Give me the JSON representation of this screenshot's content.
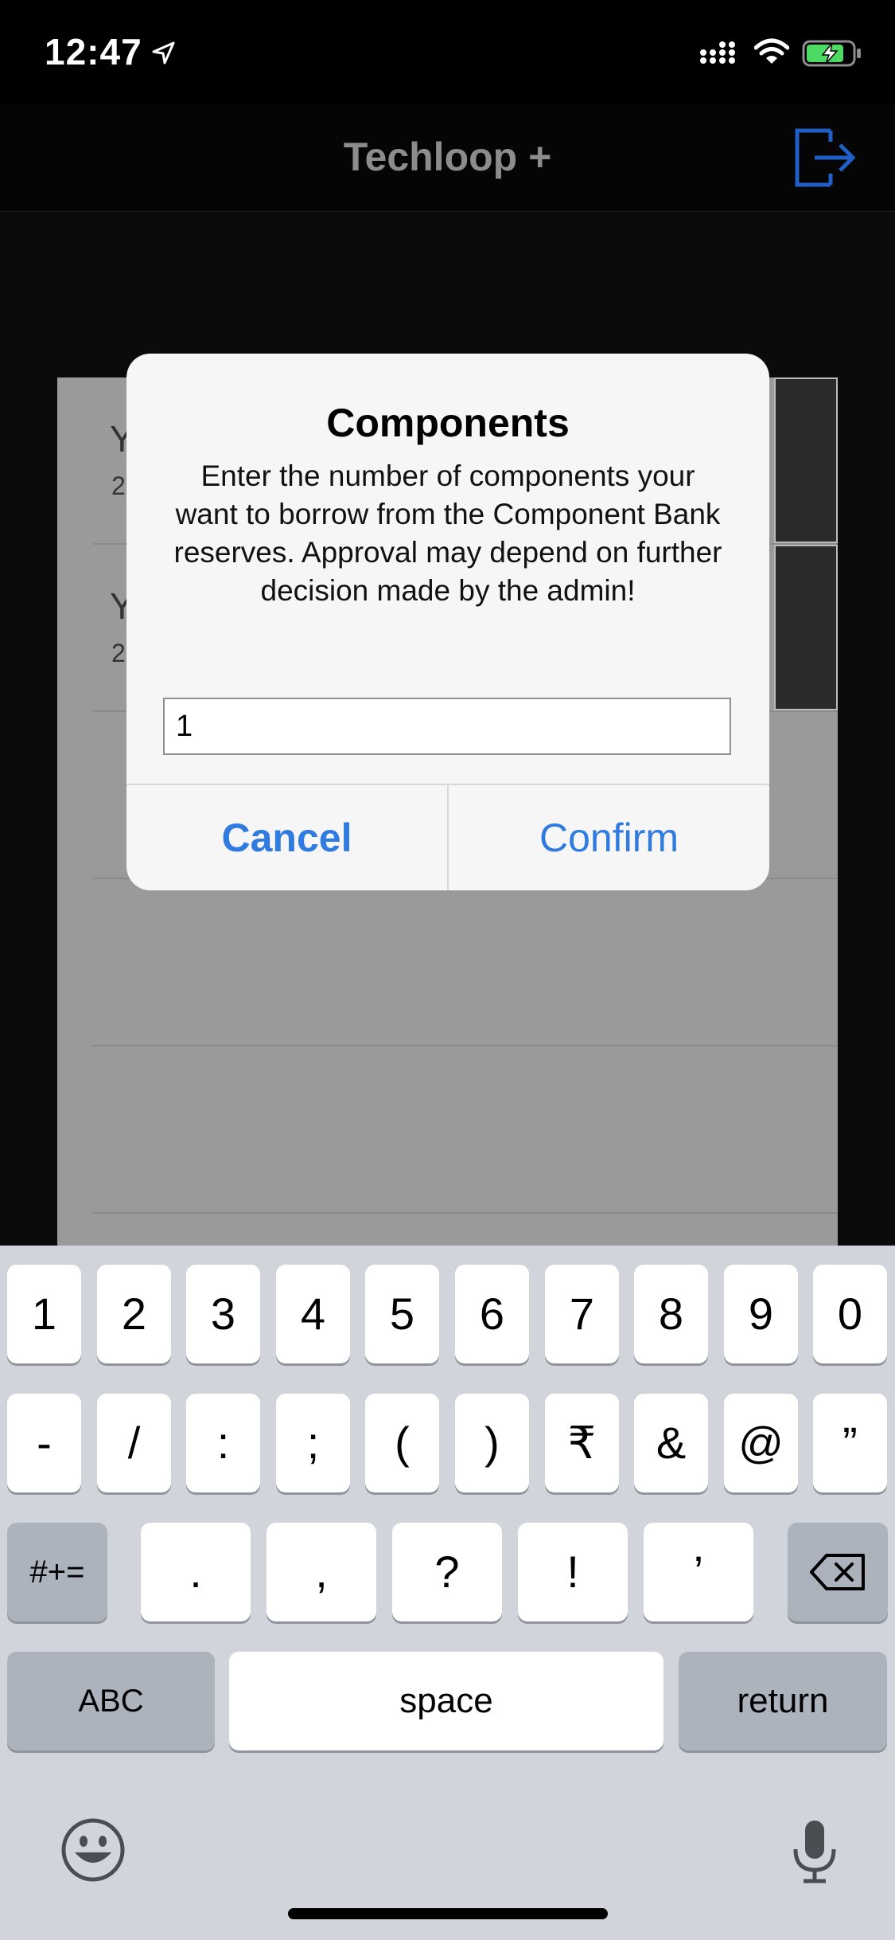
{
  "status_bar": {
    "time": "12:47"
  },
  "nav": {
    "title": "Techloop +"
  },
  "background_list": {
    "rows": [
      {
        "title": "Y",
        "subtitle": "2"
      },
      {
        "title": "Y",
        "subtitle": "2"
      }
    ]
  },
  "alert": {
    "title": "Components",
    "message": "Enter the number of components your want to borrow from the Component Bank reserves. Approval may depend on further decision made by the admin!",
    "input_value": "1",
    "cancel_label": "Cancel",
    "confirm_label": "Confirm"
  },
  "keyboard": {
    "row1": [
      "1",
      "2",
      "3",
      "4",
      "5",
      "6",
      "7",
      "8",
      "9",
      "0"
    ],
    "row2": [
      "-",
      "/",
      ":",
      ";",
      "(",
      ")",
      "₹",
      "&",
      "@",
      "”"
    ],
    "row3_mode": "#+=",
    "row3": [
      ".",
      ",",
      "?",
      "!",
      "’"
    ],
    "abc": "ABC",
    "space": "space",
    "return": "return"
  },
  "colors": {
    "accent": "#2f7be0",
    "keyboard_bg": "#d1d4db"
  }
}
